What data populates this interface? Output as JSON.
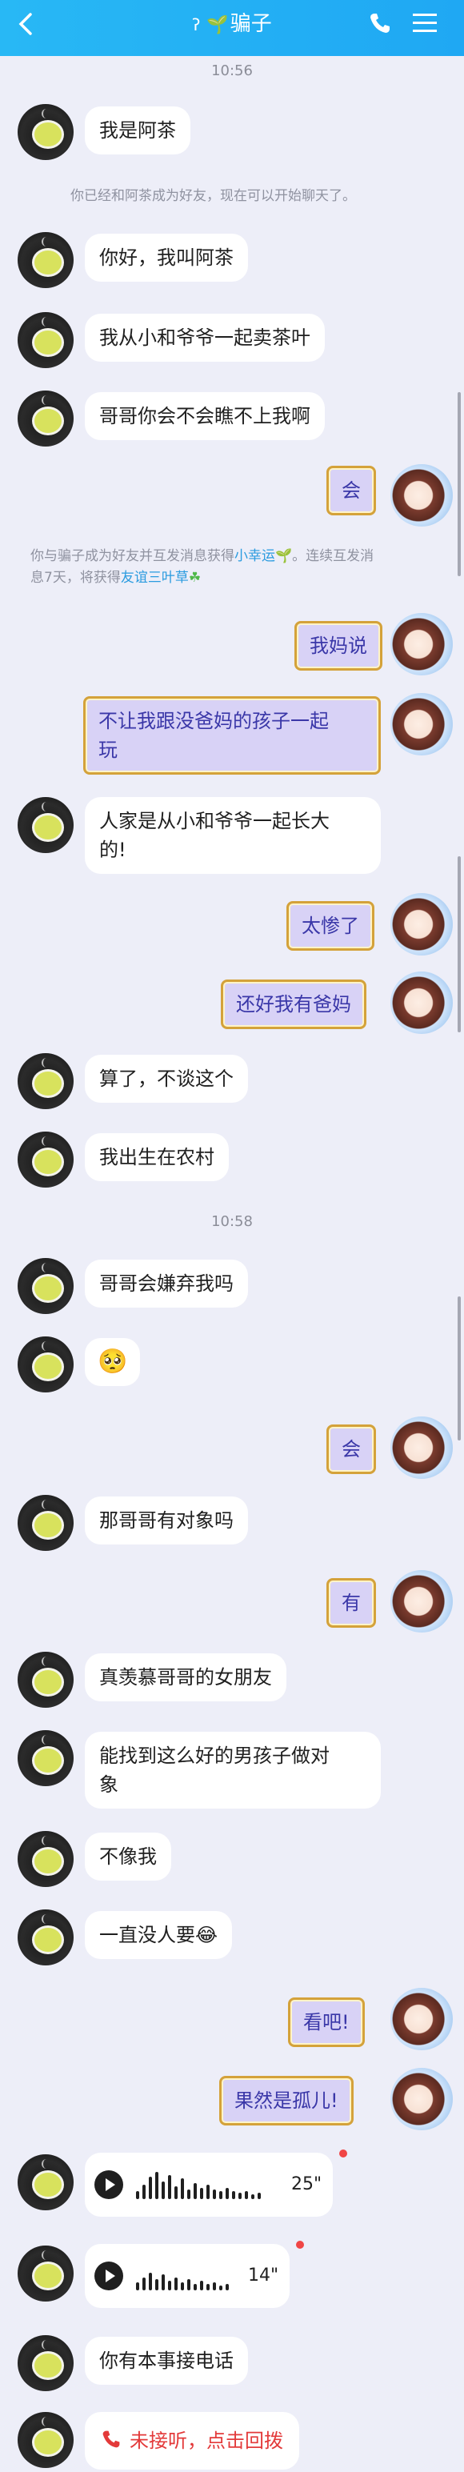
{
  "header": {
    "title": "骗子",
    "ear_icon": "ear-icon",
    "sprout_icon": "sprout-icon"
  },
  "timestamps": [
    "10:56",
    "10:58"
  ],
  "system_messages": {
    "friend_added": "你已经和阿茶成为好友，现在可以开始聊天了。",
    "luck_part1": "你与骗子成为好友并互发消息获得",
    "luck_link1": "小幸运",
    "luck_part2": "。连续互发消",
    "luck_part3": "息7天，将获得",
    "luck_link2": "友谊三叶草"
  },
  "messages": [
    {
      "side": "left",
      "text": "我是阿茶"
    },
    {
      "side": "left",
      "text": "你好，我叫阿茶"
    },
    {
      "side": "left",
      "text": "我从小和爷爷一起卖茶叶"
    },
    {
      "side": "left",
      "text": "哥哥你会不会瞧不上我啊"
    },
    {
      "side": "right",
      "text": "会"
    },
    {
      "side": "right",
      "text": "我妈说"
    },
    {
      "side": "right",
      "text": "不让我跟没爸妈的孩子一起",
      "text2": "玩"
    },
    {
      "side": "left",
      "text": "人家是从小和爷爷一起长大",
      "text2": "的!"
    },
    {
      "side": "right",
      "text": "太惨了"
    },
    {
      "side": "right",
      "text": "还好我有爸妈"
    },
    {
      "side": "left",
      "text": "算了，不谈这个"
    },
    {
      "side": "left",
      "text": "我出生在农村"
    },
    {
      "side": "left",
      "text": "哥哥会嫌弃我吗"
    },
    {
      "side": "left",
      "text": "🥺"
    },
    {
      "side": "right",
      "text": "会"
    },
    {
      "side": "left",
      "text": "那哥哥有对象吗"
    },
    {
      "side": "right",
      "text": "有"
    },
    {
      "side": "left",
      "text": "真羡慕哥哥的女朋友"
    },
    {
      "side": "left",
      "text": "能找到这么好的男孩子做对",
      "text2": "象"
    },
    {
      "side": "left",
      "text": "不像我"
    },
    {
      "side": "left",
      "text": "一直没人要😂"
    },
    {
      "side": "right",
      "text": "看吧!"
    },
    {
      "side": "right",
      "text": "果然是孤儿!"
    },
    {
      "side": "left",
      "text": "你有本事接电话"
    }
  ],
  "voice_messages": [
    {
      "duration": "25\""
    },
    {
      "duration": "14\""
    }
  ],
  "missed_call": {
    "label": "未接听，点击回拨"
  },
  "colors": {
    "accent": "#28b8f5",
    "bubble_right": "#d8d2f6",
    "bubble_right_text": "#3a37a8",
    "missed_call": "#e33a3a"
  }
}
